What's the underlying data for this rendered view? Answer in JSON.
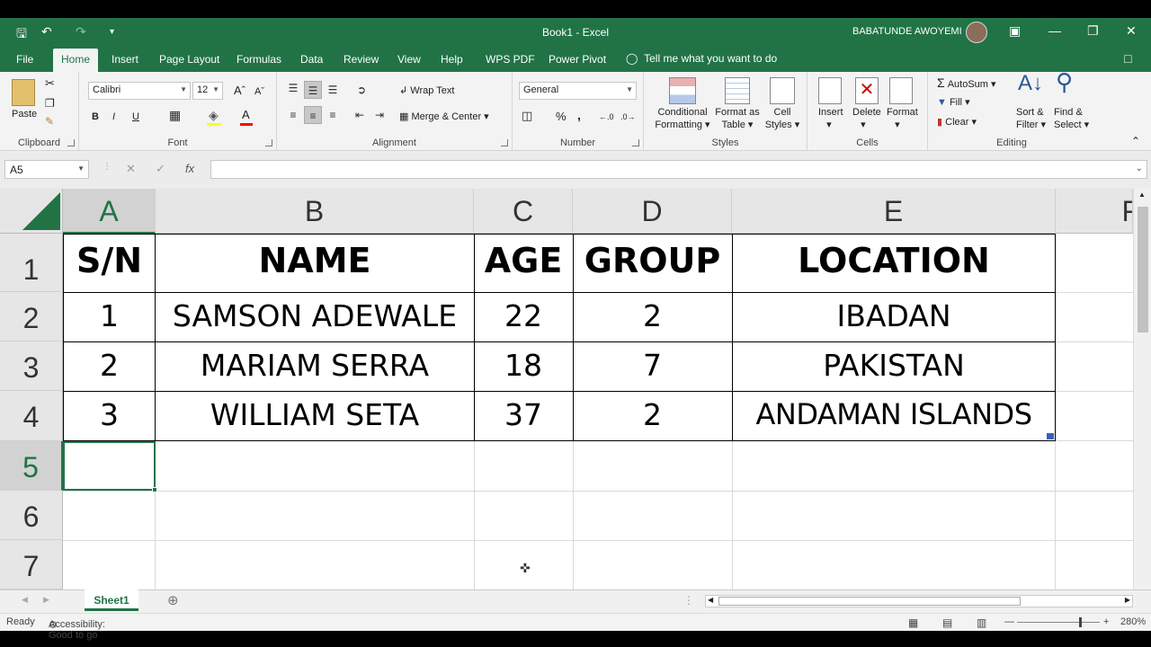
{
  "window": {
    "title": "Book1  -  Excel",
    "user": "BABATUNDE AWOYEMI"
  },
  "quick_access": {
    "save_icon": "save-icon",
    "undo_icon": "undo-icon",
    "redo_icon": "redo-icon",
    "customize_icon": "customize-icon"
  },
  "tabs": [
    "File",
    "Home",
    "Insert",
    "Page Layout",
    "Formulas",
    "Data",
    "Review",
    "View",
    "Help",
    "WPS PDF",
    "Power Pivot"
  ],
  "active_tab": "Home",
  "tell_me": "Tell me what you want to do",
  "ribbon": {
    "clipboard": {
      "label": "Clipboard",
      "paste": "Paste"
    },
    "font": {
      "label": "Font",
      "family": "Calibri",
      "size": "12",
      "bold": "B",
      "italic": "I",
      "underline": "U"
    },
    "alignment": {
      "label": "Alignment",
      "wrap_text": "Wrap Text",
      "merge_center": "Merge & Center"
    },
    "number": {
      "label": "Number",
      "format": "General",
      "percent": "%",
      "comma": ","
    },
    "styles": {
      "label": "Styles",
      "conditional_1": "Conditional",
      "conditional_2": "Formatting",
      "format_table_1": "Format as",
      "format_table_2": "Table",
      "cell_styles_1": "Cell",
      "cell_styles_2": "Styles"
    },
    "cells": {
      "label": "Cells",
      "insert": "Insert",
      "delete": "Delete",
      "format": "Format"
    },
    "editing": {
      "label": "Editing",
      "autosum": "AutoSum",
      "fill": "Fill",
      "clear": "Clear",
      "sort_1": "Sort &",
      "sort_2": "Filter",
      "find_1": "Find &",
      "find_2": "Select"
    }
  },
  "formula_bar": {
    "name_box": "A5",
    "fx": "fx",
    "value": ""
  },
  "columns": [
    "A",
    "B",
    "C",
    "D",
    "E",
    "F"
  ],
  "rows": [
    "1",
    "2",
    "3",
    "4",
    "5",
    "6",
    "7"
  ],
  "selected_cell": "A5",
  "table": {
    "headers": [
      "S/N",
      "NAME",
      "AGE",
      "GROUP",
      "LOCATION"
    ],
    "rows": [
      [
        "1",
        "SAMSON ADEWALE",
        "22",
        "2",
        "IBADAN"
      ],
      [
        "2",
        "MARIAM SERRA",
        "18",
        "7",
        "PAKISTAN"
      ],
      [
        "3",
        "WILLIAM SETA",
        "37",
        "2",
        "ANDAMAN ISLANDS"
      ]
    ]
  },
  "sheets": [
    "Sheet1"
  ],
  "status": {
    "ready": "Ready",
    "accessibility": "Accessibility: Good to go",
    "zoom": "280%"
  },
  "colors": {
    "brand": "#217346"
  }
}
